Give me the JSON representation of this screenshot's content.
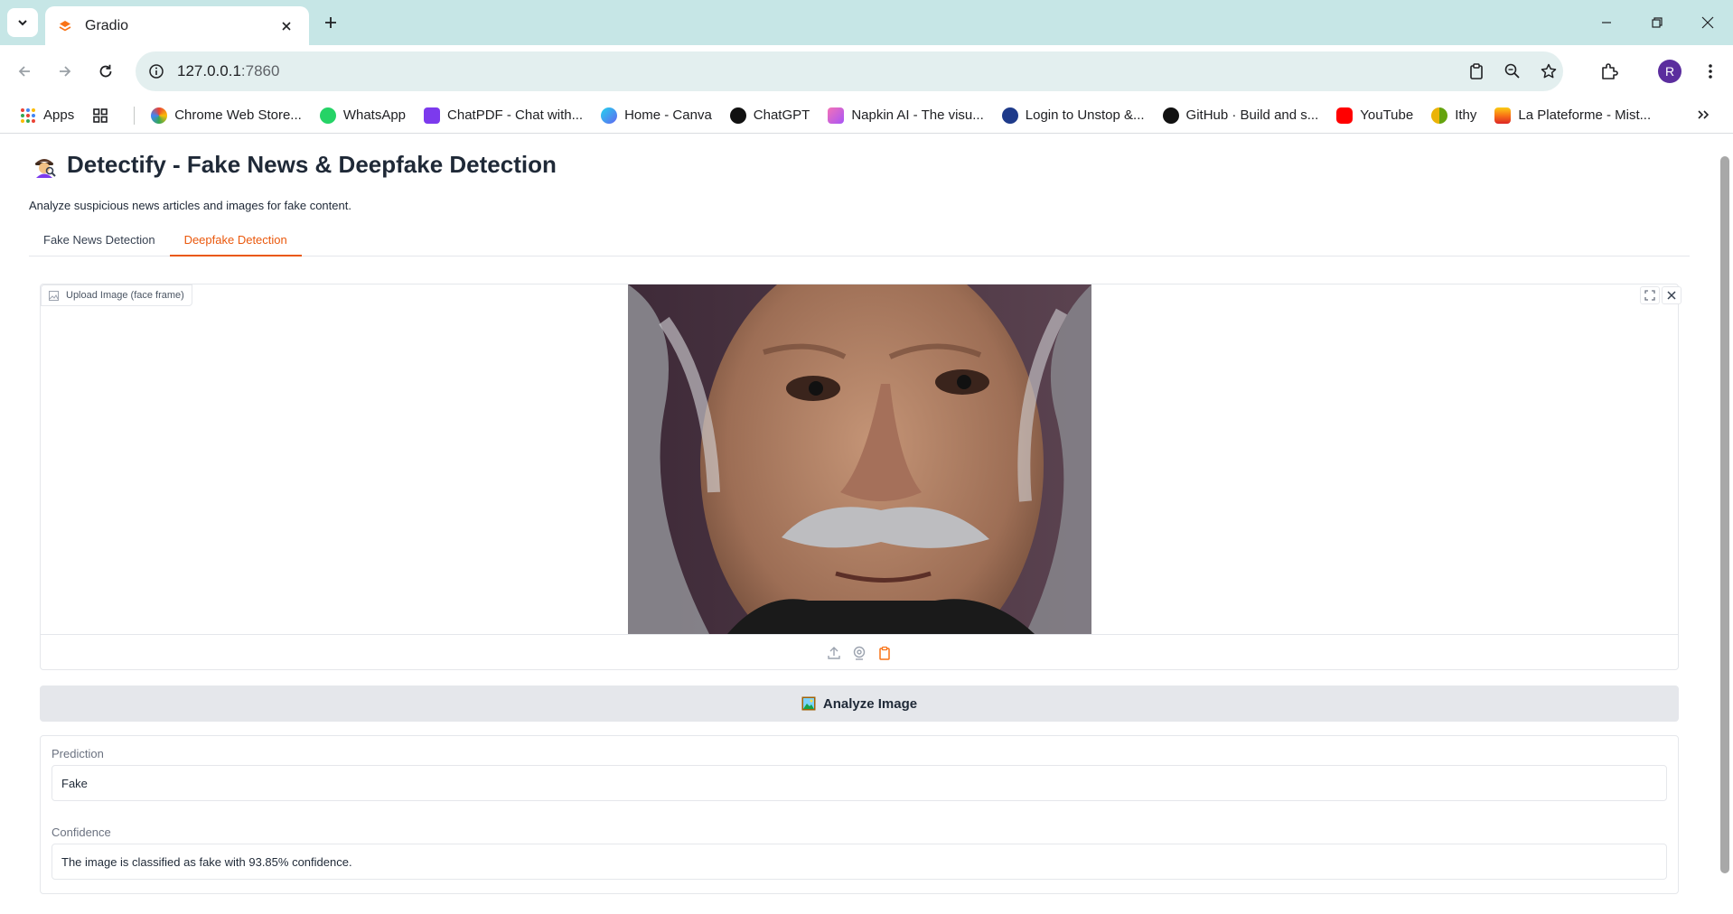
{
  "browser": {
    "tab_title": "Gradio",
    "url_host": "127.0.0.1",
    "url_port": ":7860",
    "profile_initial": "R",
    "bookmarks": [
      {
        "label": "Apps",
        "color": "#ea4335"
      },
      {
        "label": "Chrome Web Store...",
        "color": "#fbbc05"
      },
      {
        "label": "WhatsApp",
        "color": "#25d366"
      },
      {
        "label": "ChatPDF - Chat with...",
        "color": "#7c3aed"
      },
      {
        "label": "Home - Canva",
        "color": "#3b82f6"
      },
      {
        "label": "ChatGPT",
        "color": "#111111"
      },
      {
        "label": "Napkin AI - The visu...",
        "color": "#d946ef"
      },
      {
        "label": "Login to Unstop &...",
        "color": "#1e3a8a"
      },
      {
        "label": "GitHub · Build and s...",
        "color": "#111111"
      },
      {
        "label": "YouTube",
        "color": "#ff0000"
      },
      {
        "label": "Ithy",
        "color": "#eab308"
      },
      {
        "label": "La Plateforme - Mist...",
        "color": "#f97316"
      }
    ]
  },
  "app": {
    "title": "Detectify - Fake News & Deepfake Detection",
    "subtitle": "Analyze suspicious news articles and images for fake content.",
    "tabs": [
      "Fake News Detection",
      "Deepfake Detection"
    ],
    "active_tab": "Deepfake Detection",
    "image_input": {
      "label": "Upload Image (face frame)"
    },
    "analyze_button": "Analyze Image",
    "outputs": {
      "prediction_label": "Prediction",
      "prediction_value": "Fake",
      "confidence_label": "Confidence",
      "confidence_value": "The image is classified as fake with 93.85% confidence."
    }
  }
}
